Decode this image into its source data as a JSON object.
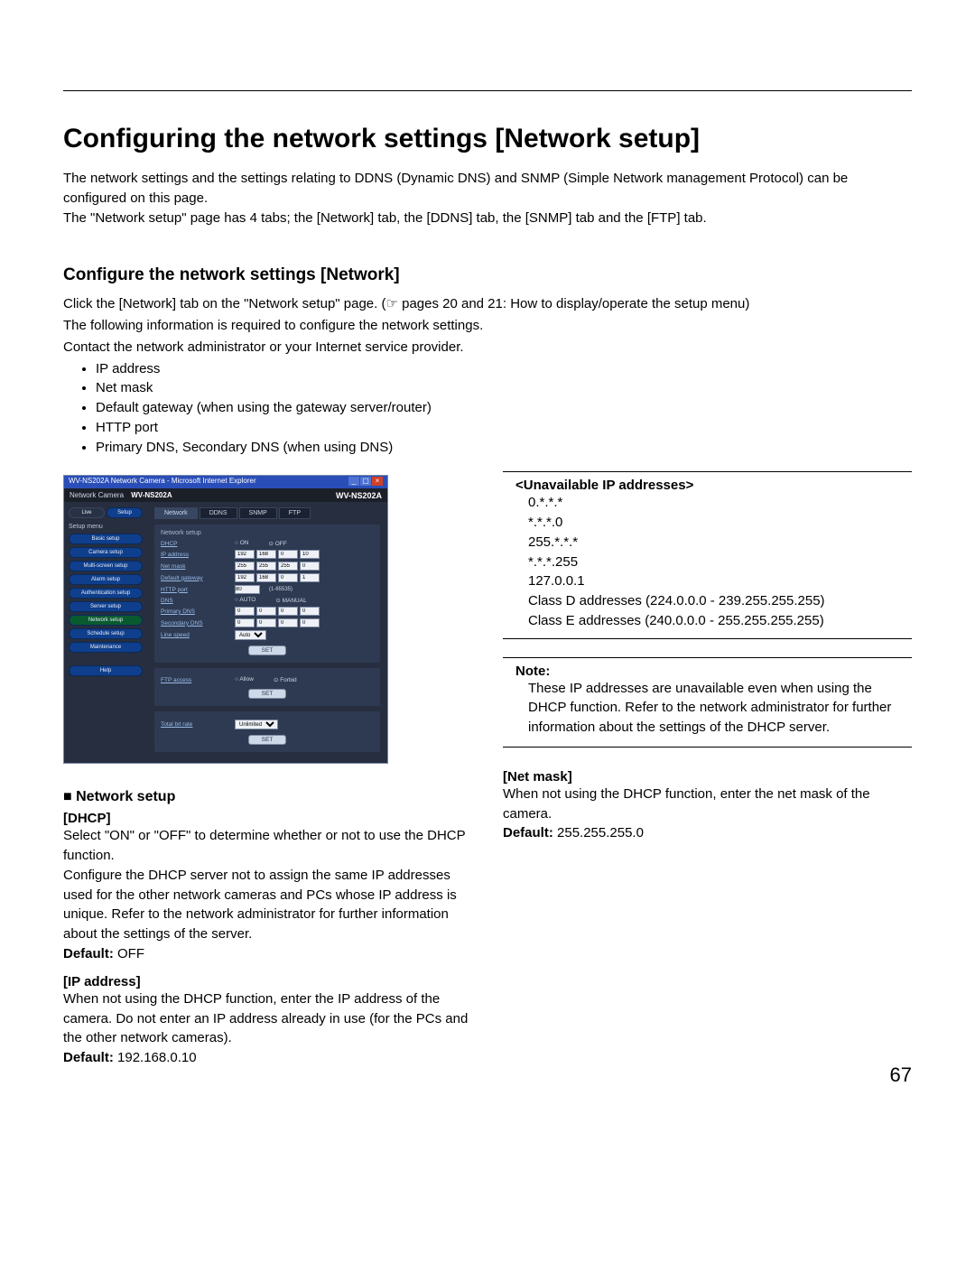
{
  "page_number": "67",
  "h1": "Configuring the network settings [Network setup]",
  "intro1": "The network settings and the settings relating to DDNS (Dynamic DNS) and SNMP (Simple Network management Protocol) can be configured on this page.",
  "intro2": "The \"Network setup\" page has 4 tabs; the [Network] tab, the [DDNS] tab, the [SNMP] tab and the [FTP] tab.",
  "h2": "Configure the network settings [Network]",
  "sec1": "Click the [Network] tab on the \"Network setup\" page. (☞ pages 20 and 21: How to display/operate the setup menu)",
  "sec2": "The following information is required to configure the network settings.",
  "sec3": "Contact the network administrator or your Internet service provider.",
  "bullets": [
    "IP address",
    "Net mask",
    "Default gateway (when using the gateway server/router)",
    "HTTP port",
    "Primary DNS, Secondary DNS (when using DNS)"
  ],
  "screenshot": {
    "title": "WV-NS202A Network Camera - Microsoft Internet Explorer",
    "brand": "Network Camera",
    "model": "WV-NS202A",
    "modelrow_right": "WV-NS202A",
    "live": "Live",
    "setup": "Setup",
    "menu_label": "Setup menu",
    "side": [
      "Basic setup",
      "Camera setup",
      "Multi-screen setup",
      "Alarm setup",
      "Authentication setup",
      "Server setup",
      "Network setup",
      "Schedule setup",
      "Maintenance",
      "Help"
    ],
    "tabs": [
      "Network",
      "DDNS",
      "SNMP",
      "FTP"
    ],
    "active_tab": 0,
    "panel1_title": "Network setup",
    "labels": {
      "dhcp": "DHCP",
      "ip": "IP address",
      "nm": "Net mask",
      "gw": "Default gateway",
      "http": "HTTP port",
      "dns": "DNS",
      "pdns": "Primary DNS",
      "sdns": "Secondary DNS",
      "ls": "Line speed"
    },
    "radios": {
      "dhcp_on": "ON",
      "dhcp_off": "OFF",
      "dns_auto": "AUTO",
      "dns_manual": "MANUAL"
    },
    "ip_vals": [
      "192",
      "168",
      "0",
      "10"
    ],
    "nm_vals": [
      "255",
      "255",
      "255",
      "0"
    ],
    "gw_vals": [
      "192",
      "168",
      "0",
      "1"
    ],
    "http_val": "80",
    "http_hint": "(1-65535)",
    "pdns_vals": [
      "0",
      "0",
      "0",
      "0"
    ],
    "sdns_vals": [
      "0",
      "0",
      "0",
      "0"
    ],
    "ls_val": "Auto",
    "set": "SET",
    "panel2_label": "FTP access",
    "ftp_allow": "Allow",
    "ftp_forbid": "Forbid",
    "panel3_label": "Total bit rate",
    "panel3_val": "Unlimited"
  },
  "left_section": {
    "heading": "■ Network setup",
    "dhcp_h": "[DHCP]",
    "dhcp_p1": "Select \"ON\" or \"OFF\" to determine whether or not to use the DHCP function.",
    "dhcp_p2": "Configure the DHCP server not to assign the same IP addresses used for the other network cameras and PCs whose IP address is unique. Refer to the network administrator for further information about the settings of the server.",
    "dhcp_def_l": "Default:",
    "dhcp_def_v": " OFF",
    "ip_h": "[IP address]",
    "ip_p": "When not using the DHCP function, enter the IP address of the camera. Do not enter an IP address already in use (for the PCs and the other network cameras).",
    "ip_def_l": "Default:",
    "ip_def_v": " 192.168.0.10"
  },
  "right_section": {
    "unav_h": "<Unavailable IP addresses>",
    "lines": [
      "0.*.*.*",
      "*.*.*.0",
      "255.*.*.*",
      "*.*.*.255",
      "127.0.0.1",
      "Class D addresses (224.0.0.0 - 239.255.255.255)",
      "Class E addresses (240.0.0.0 - 255.255.255.255)"
    ],
    "note_h": "Note:",
    "note_b": "These IP addresses are unavailable even when using the DHCP function. Refer to the network administrator for further information about the settings of the DHCP server.",
    "nm_h": "[Net mask]",
    "nm_p": "When not using the DHCP function, enter the net mask of the camera.",
    "nm_def_l": "Default:",
    "nm_def_v": " 255.255.255.0"
  }
}
